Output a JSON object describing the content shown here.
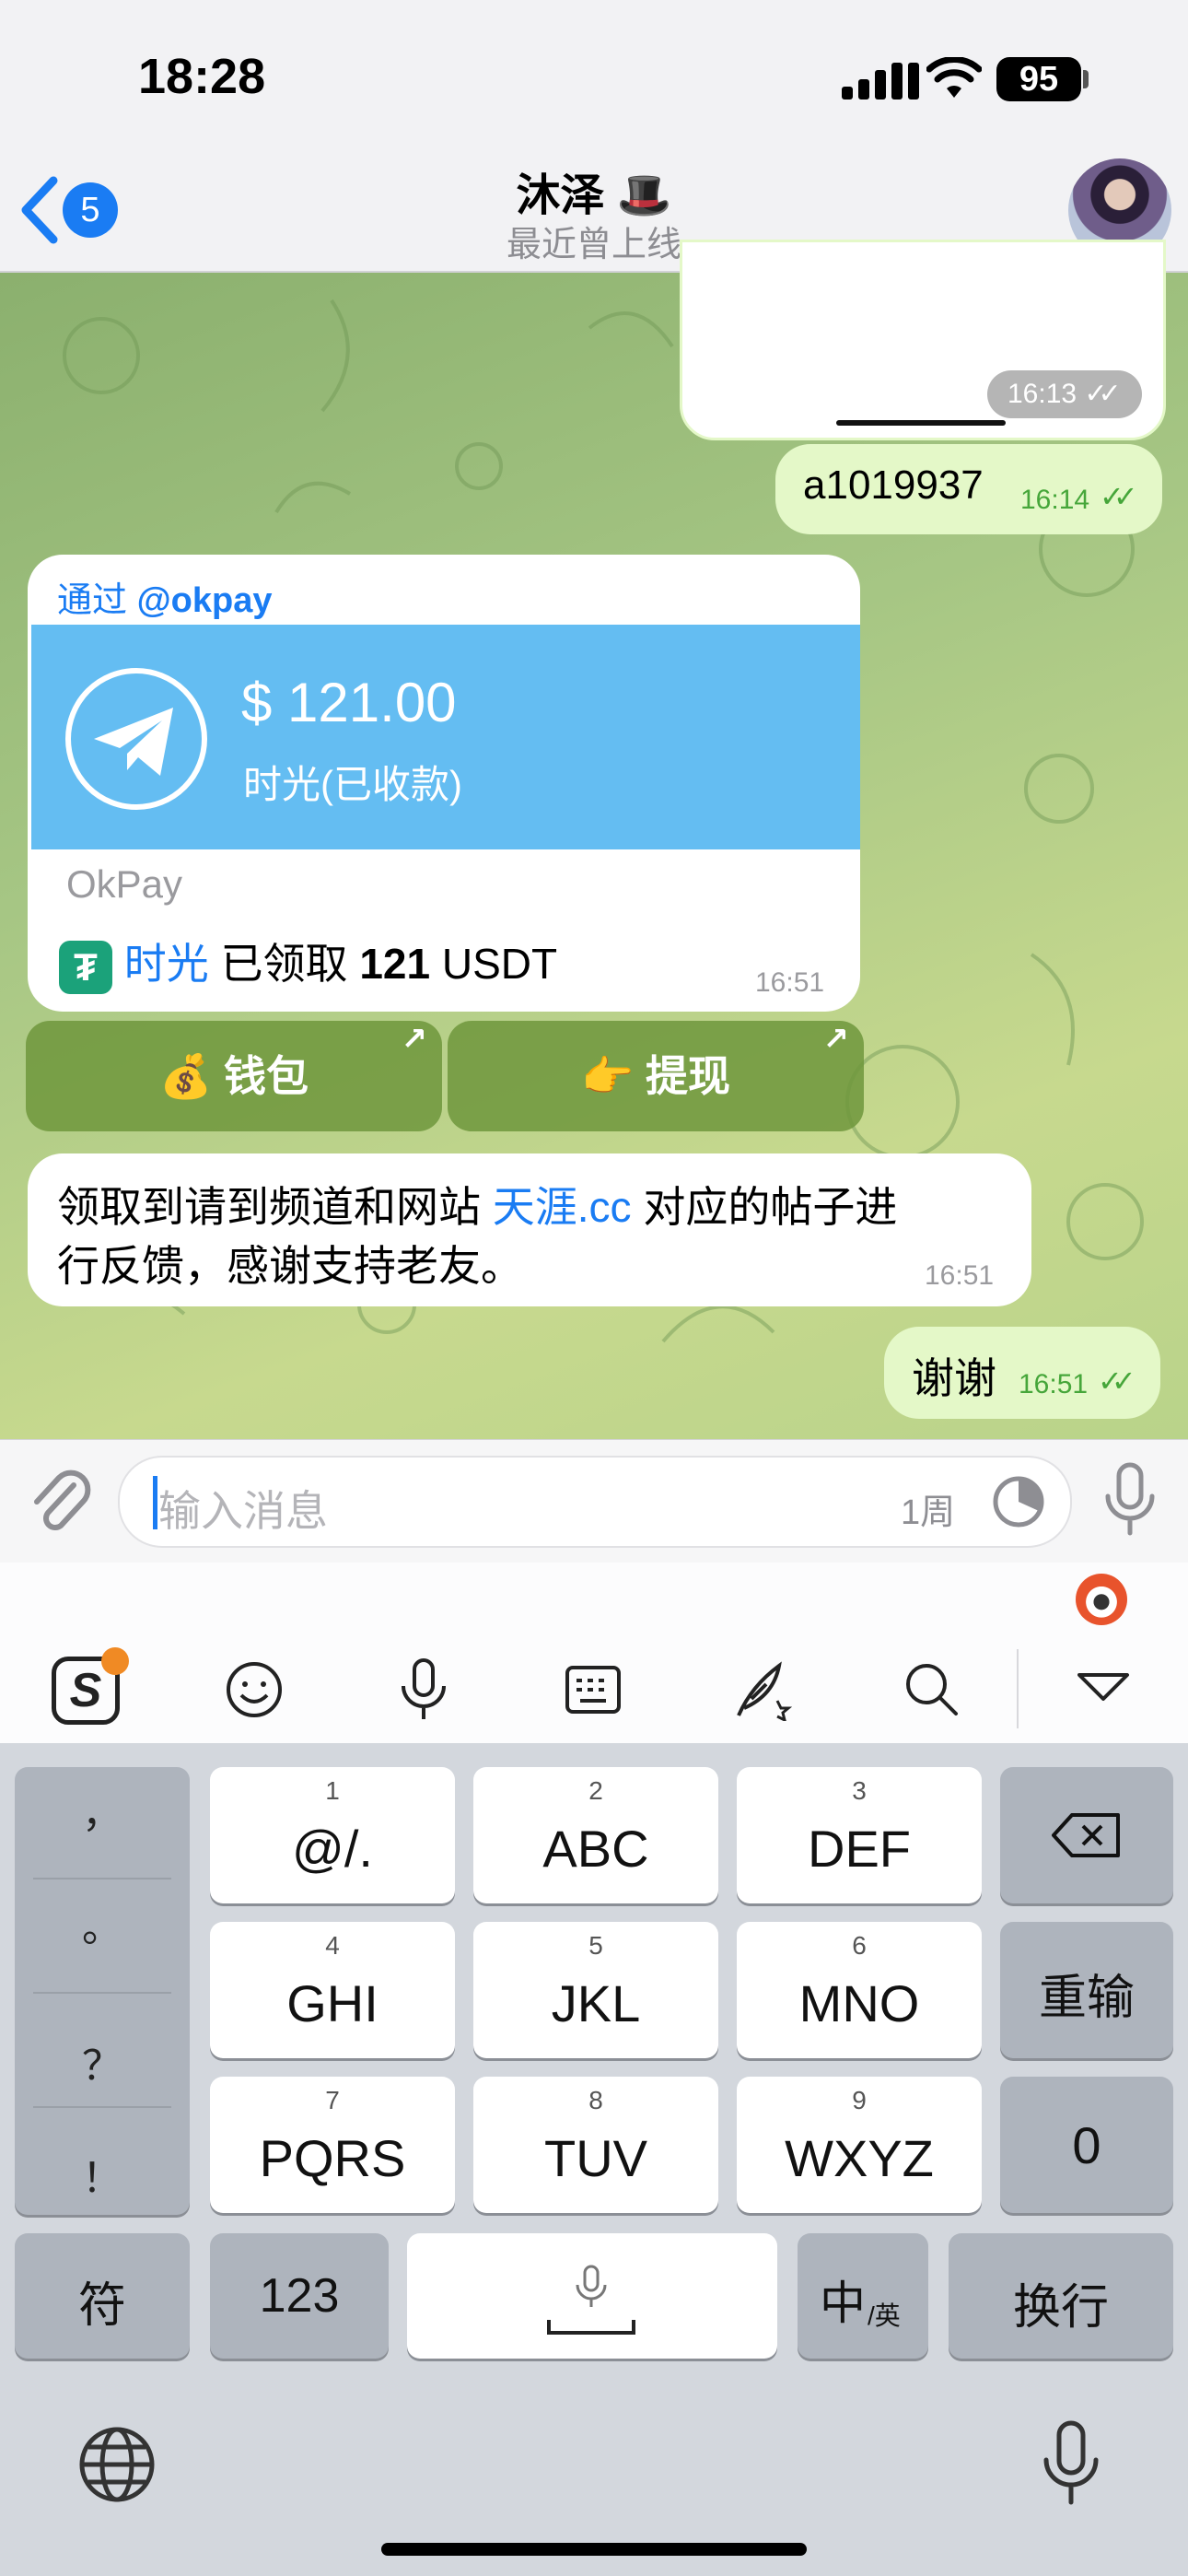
{
  "status_bar": {
    "time": "18:28",
    "battery": "95"
  },
  "header": {
    "back_badge": "5",
    "title": "沐泽 🎩",
    "subtitle": "最近曾上线"
  },
  "messages": [
    {
      "type": "out-image",
      "time": "16:13",
      "read": true
    },
    {
      "type": "out-text",
      "text": "a1019937",
      "time": "16:14",
      "read": true
    },
    {
      "type": "in-invoice",
      "via_prefix": "通过",
      "via_bot": "@okpay",
      "amount": "$ 121.00",
      "payee": "时光(已收款)",
      "brand": "OkPay",
      "claim_user": "时光",
      "claim_text_a": " 已领取 ",
      "claim_amount": "121",
      "claim_text_b": " USDT",
      "time": "16:51"
    },
    {
      "type": "in-text",
      "text_a": "领取到请到频道和网站 ",
      "link": "天涯.cc",
      "text_b": " 对应的帖子进",
      "text_c": "行反馈，感谢支持老友。",
      "time": "16:51"
    },
    {
      "type": "out-text",
      "text": "谢谢",
      "time": "16:51",
      "read": true
    }
  ],
  "inline_buttons": [
    {
      "emoji": "💰",
      "label": "钱包"
    },
    {
      "emoji": "👉",
      "label": "提现"
    }
  ],
  "composer": {
    "placeholder": "输入消息",
    "timer": "1周"
  },
  "keyboard": {
    "side_punct": [
      "，",
      "。",
      "？",
      "！"
    ],
    "rows": [
      [
        {
          "num": "1",
          "label": "@/."
        },
        {
          "num": "2",
          "label": "ABC"
        },
        {
          "num": "3",
          "label": "DEF"
        }
      ],
      [
        {
          "num": "4",
          "label": "GHI"
        },
        {
          "num": "5",
          "label": "JKL"
        },
        {
          "num": "6",
          "label": "MNO"
        }
      ],
      [
        {
          "num": "7",
          "label": "PQRS"
        },
        {
          "num": "8",
          "label": "TUV"
        },
        {
          "num": "9",
          "label": "WXYZ"
        }
      ]
    ],
    "reinput": "重输",
    "zero": "0",
    "symbols": "符",
    "numbers": "123",
    "lang_main": "中",
    "lang_sub": "/英",
    "enter": "换行"
  },
  "colors": {
    "accent": "#1a7cf3",
    "out_bubble": "#e4f8c8",
    "invoice_banner": "#64bdf2",
    "tick": "#46a63a"
  }
}
